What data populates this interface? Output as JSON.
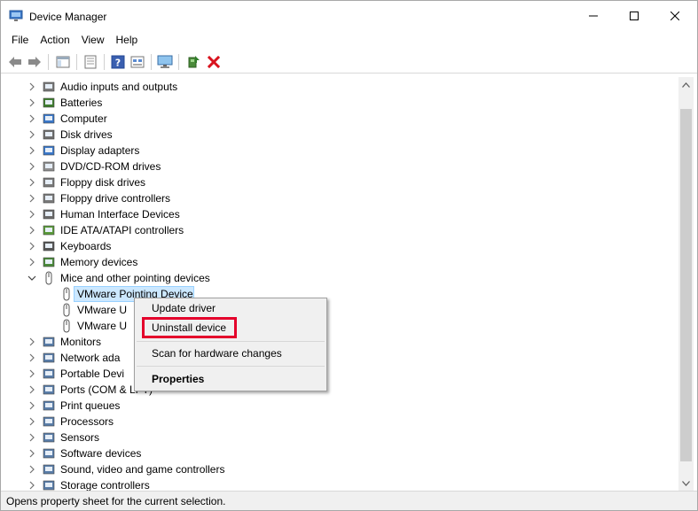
{
  "window": {
    "title": "Device Manager"
  },
  "menubar": [
    "File",
    "Action",
    "View",
    "Help"
  ],
  "toolbar": {
    "buttons": [
      "back-arrow-icon",
      "forward-arrow-icon",
      "show-hide-tree-icon",
      "properties-sheet-icon",
      "help-icon",
      "view-list-icon",
      "monitor-scan-icon",
      "update-driver-icon",
      "uninstall-x-icon"
    ]
  },
  "tree": {
    "categories": [
      "Audio inputs and outputs",
      "Batteries",
      "Computer",
      "Disk drives",
      "Display adapters",
      "DVD/CD-ROM drives",
      "Floppy disk drives",
      "Floppy drive controllers",
      "Human Interface Devices",
      "IDE ATA/ATAPI controllers",
      "Keyboards",
      "Memory devices",
      "Mice and other pointing devices"
    ],
    "children": [
      "VMware Pointing Device",
      "VMware U",
      "VMware U"
    ],
    "categories_after": [
      "Monitors",
      "Network ada",
      "Portable Devi",
      "Ports (COM & LPT)",
      "Print queues",
      "Processors",
      "Sensors",
      "Software devices",
      "Sound, video and game controllers",
      "Storage controllers"
    ]
  },
  "context_menu": {
    "update": "Update driver",
    "uninstall": "Uninstall device",
    "scan": "Scan for hardware changes",
    "properties": "Properties"
  },
  "status": "Opens property sheet for the current selection.",
  "colors": {
    "highlight": "#e4002b",
    "selection": "#cce8ff"
  }
}
